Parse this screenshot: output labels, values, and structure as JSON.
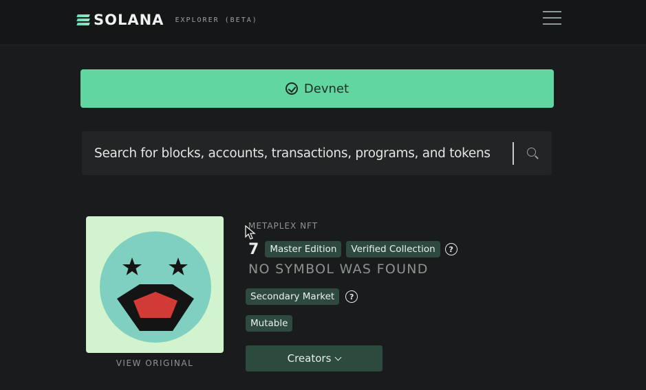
{
  "header": {
    "brand": "SOLANA",
    "subtitle": "EXPLORER (BETA)",
    "logo_icon": "solana-logo-icon",
    "menu_icon": "hamburger-menu-icon"
  },
  "network": {
    "label": "Devnet",
    "icon": "check-circle-icon",
    "color": "#62d6a1"
  },
  "search": {
    "placeholder": "Search for blocks, accounts, transactions, programs, and tokens",
    "icon": "search-icon"
  },
  "nft": {
    "view_original": "VIEW ORIGINAL",
    "category": "METAPLEX NFT",
    "edition": "7",
    "badges": [
      "Master Edition",
      "Verified Collection"
    ],
    "symbol": "NO SYMBOL WAS FOUND",
    "market_badge": "Secondary Market",
    "mutable_badge": "Mutable",
    "creators_label": "Creators",
    "help_icon": "question-circle-icon"
  },
  "colors": {
    "accent": "#62d6a1",
    "badge_bg": "#2e4a40",
    "background": "#1a1b1c"
  }
}
